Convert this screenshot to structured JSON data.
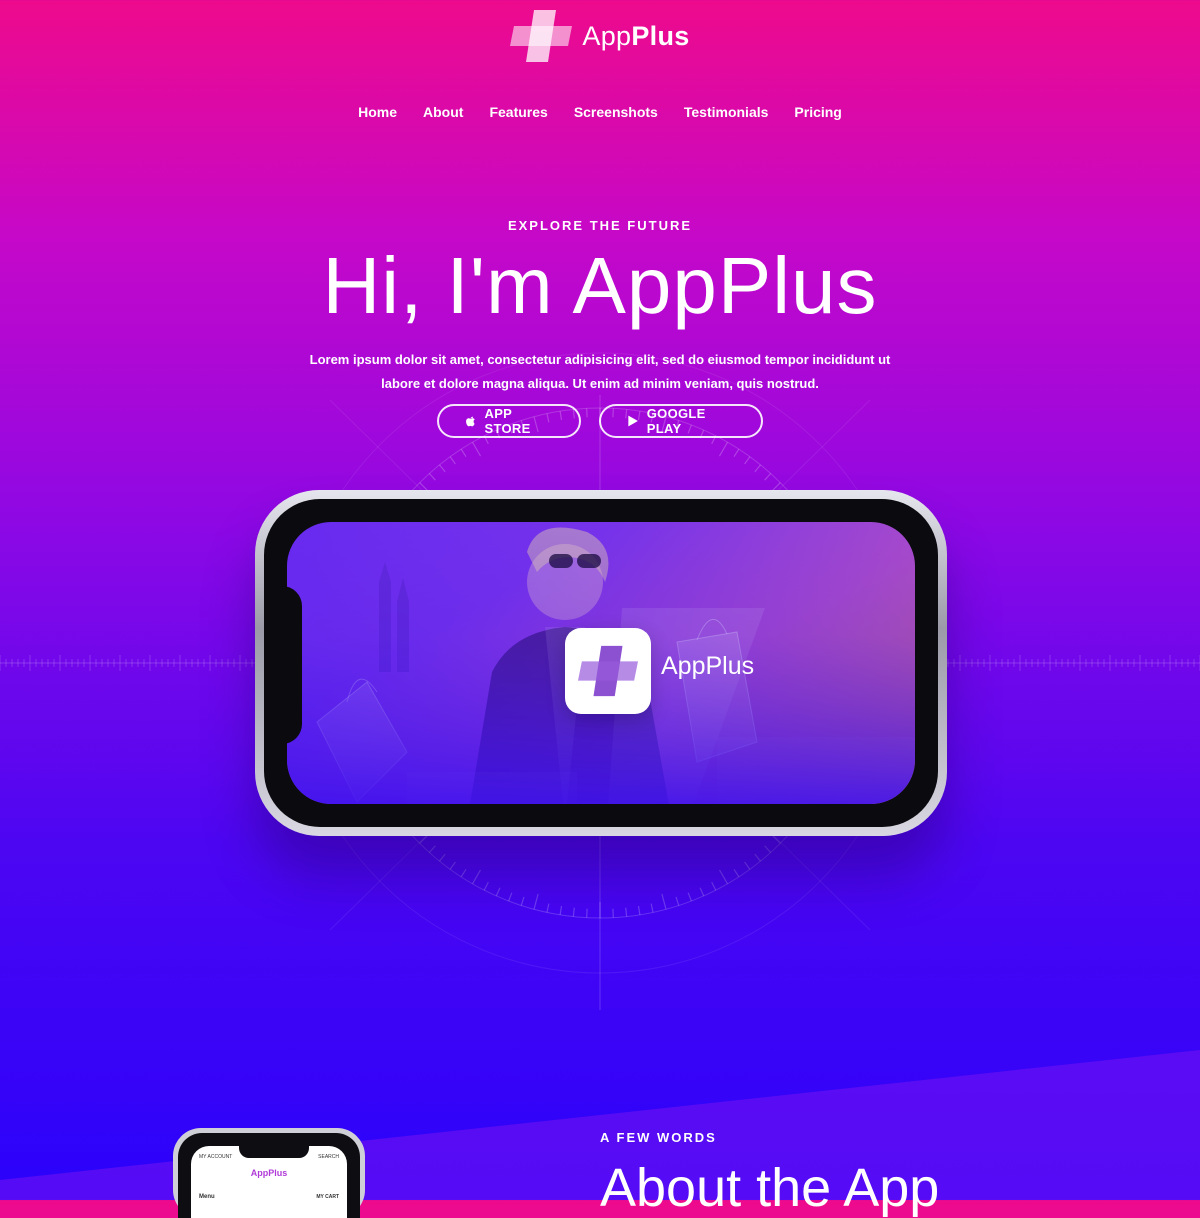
{
  "brand": {
    "name_light": "App",
    "name_bold": "Plus"
  },
  "nav": [
    {
      "label": "Home"
    },
    {
      "label": "About"
    },
    {
      "label": "Features"
    },
    {
      "label": "Screenshots"
    },
    {
      "label": "Testimonials"
    },
    {
      "label": "Pricing"
    }
  ],
  "hero": {
    "kicker": "EXPLORE THE FUTURE",
    "headline": "Hi, I'm AppPlus",
    "lead": "Lorem ipsum dolor sit amet, consectetur adipisicing elit, sed do eiusmod tempor incididunt ut labore et dolore magna aliqua. Ut enim ad minim veniam, quis nostrud.",
    "app_store": {
      "label": "APP STORE",
      "icon": "apple-icon"
    },
    "google_play": {
      "label": "GOOGLE PLAY",
      "icon": "play-icon"
    }
  },
  "phone_screen": {
    "app_name_light": "App",
    "app_name_bold": "Plus"
  },
  "about": {
    "kicker": "A FEW WORDS",
    "title": "About the App",
    "mini_phone": {
      "top_left": "MY ACCOUNT",
      "top_right": "SEARCH",
      "brand": "AppPlus",
      "menu": "Menu",
      "cart": "MY CART"
    }
  },
  "colors": {
    "top": "#ee0a8c",
    "middle": "#8a08e6",
    "bottom": "#2a02fb"
  }
}
